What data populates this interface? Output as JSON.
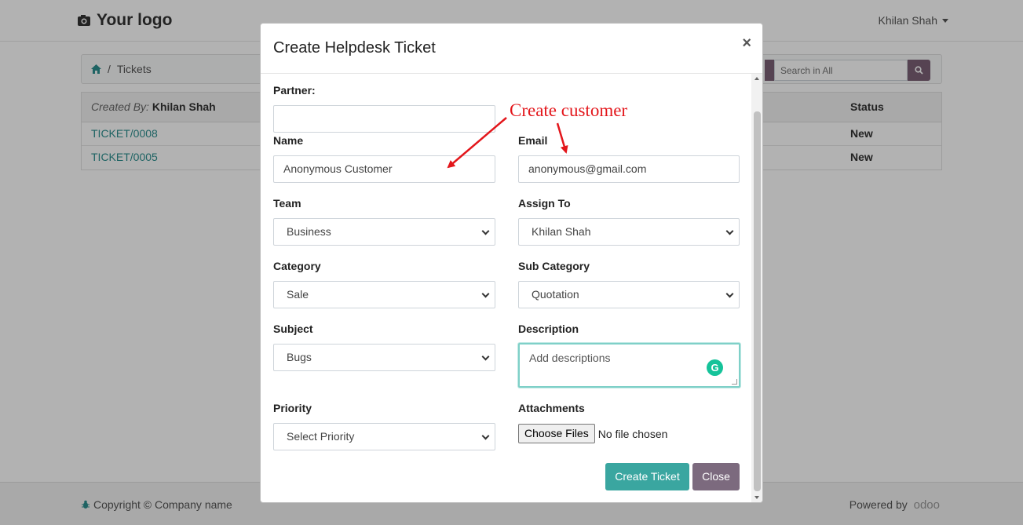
{
  "navbar": {
    "logo_text": "Your logo",
    "logo_icon": "camera-icon",
    "user_name": "Khilan Shah"
  },
  "breadcrumb": {
    "home_icon": "home-icon",
    "separator": "/",
    "current": "Tickets"
  },
  "search": {
    "placeholder": "Search in All"
  },
  "table": {
    "created_by_label": "Created By:",
    "created_by_value": "Khilan Shah",
    "status_header": "Status",
    "rows": [
      {
        "ticket": "TICKET/0008",
        "status": "New"
      },
      {
        "ticket": "TICKET/0005",
        "status": "New"
      }
    ]
  },
  "footer": {
    "copyright": "Copyright © Company name",
    "powered_by": "Powered by",
    "odoo": "odoo"
  },
  "modal": {
    "title": "Create Helpdesk Ticket",
    "close_symbol": "×",
    "partner_label": "Partner:",
    "partner_value": "",
    "name_label": "Name",
    "name_value": "Anonymous Customer",
    "email_label": "Email",
    "email_value": "anonymous@gmail.com",
    "team_label": "Team",
    "team_value": "Business",
    "assign_label": "Assign To",
    "assign_value": "Khilan Shah",
    "category_label": "Category",
    "category_value": "Sale",
    "subcategory_label": "Sub Category",
    "subcategory_value": "Quotation",
    "subject_label": "Subject",
    "subject_value": "Bugs",
    "description_label": "Description",
    "description_placeholder": "Add descriptions",
    "priority_label": "Priority",
    "priority_value": "Select Priority",
    "attachments_label": "Attachments",
    "choose_files": "Choose Files",
    "no_file": "No file chosen",
    "create_button": "Create Ticket",
    "close_button": "Close"
  },
  "annotation": {
    "text": "Create customer",
    "color": "#e3161b"
  },
  "colors": {
    "teal_accent": "#3aa6a0",
    "close_button": "#7c6a7e",
    "link": "#2c8f8f"
  }
}
